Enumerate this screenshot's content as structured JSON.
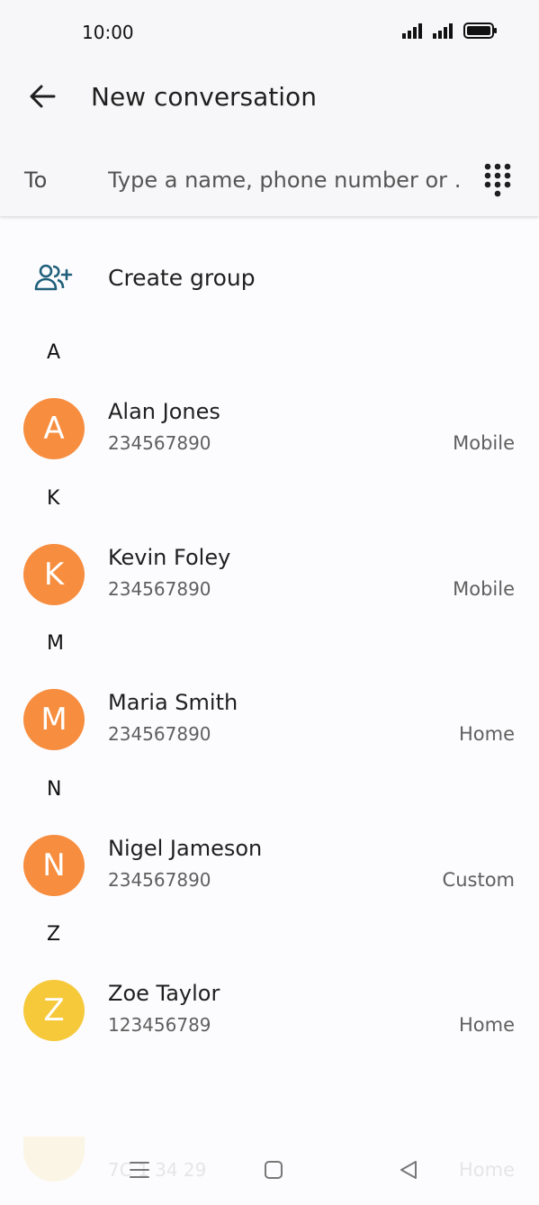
{
  "status": {
    "time": "10:00"
  },
  "header": {
    "title": "New conversation",
    "to_label": "To",
    "to_placeholder": "Type a name, phone number or …",
    "to_value": ""
  },
  "create_group": {
    "label": "Create group"
  },
  "sections": [
    {
      "letter": "A",
      "contact": {
        "initial": "A",
        "name": "Alan Jones",
        "number": "234567890",
        "type": "Mobile",
        "color": "#f78d3f"
      }
    },
    {
      "letter": "K",
      "contact": {
        "initial": "K",
        "name": "Kevin Foley",
        "number": "234567890",
        "type": "Mobile",
        "color": "#f78d3f"
      }
    },
    {
      "letter": "M",
      "contact": {
        "initial": "M",
        "name": "Maria Smith",
        "number": "234567890",
        "type": "Home",
        "color": "#f78d3f"
      }
    },
    {
      "letter": "N",
      "contact": {
        "initial": "N",
        "name": "Nigel Jameson",
        "number": "234567890",
        "type": "Custom",
        "color": "#f78d3f"
      }
    },
    {
      "letter": "Z",
      "contact": {
        "initial": "Z",
        "name": "Zoe Taylor",
        "number": "123456789",
        "type": "Home",
        "color": "#f6c93a"
      }
    }
  ],
  "ghost": {
    "number": "7C 1 34 29",
    "type": "Home"
  },
  "colors": {
    "accent": "#0b57d0",
    "icon_teal": "#1f5f7a",
    "avatar_orange": "#f78d3f",
    "avatar_yellow": "#f6c93a"
  },
  "icons": {
    "back": "arrow-left-icon",
    "dialpad": "dialpad-icon",
    "create_group": "add-group-icon",
    "nav_recents": "menu-lines-icon",
    "nav_home": "square-icon",
    "nav_back": "triangle-back-icon"
  }
}
